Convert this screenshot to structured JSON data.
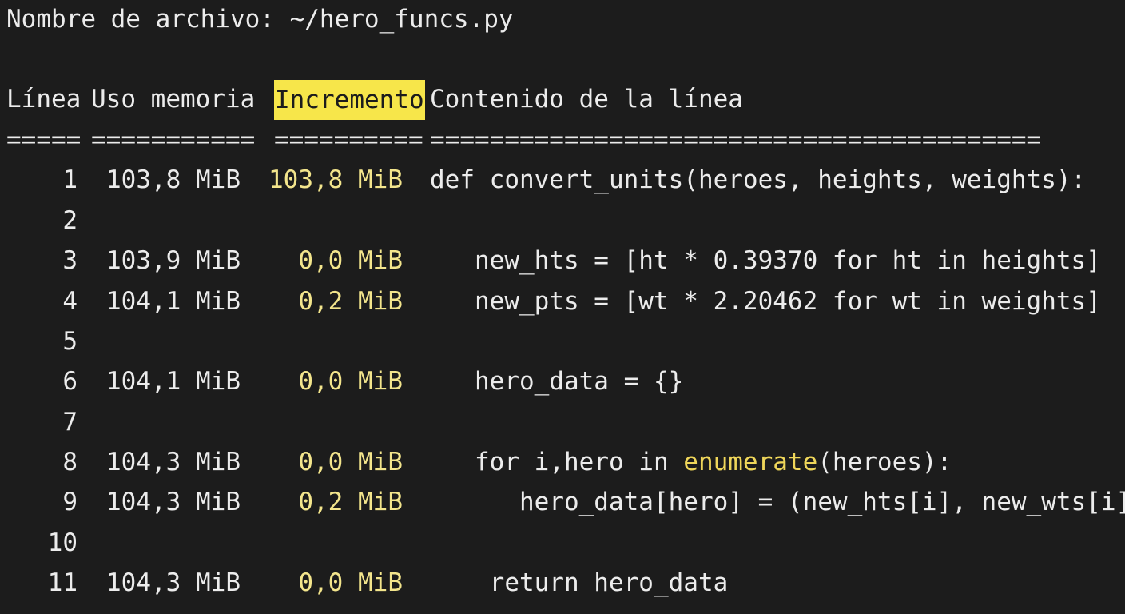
{
  "file": {
    "label": "Nombre de archivo: ~/hero_funcs.py"
  },
  "header": {
    "line": "Línea",
    "memory": "Uso memoria",
    "increment": "Incremento",
    "content": "Contenido de la línea"
  },
  "separator": {
    "line": "=====",
    "memory": "===========",
    "increment": "==========",
    "content": "========================================="
  },
  "rows": [
    {
      "num": "1",
      "mem": "103,8 MiB",
      "inc": "103,8 MiB",
      "code": "def convert_units(heroes, heights, weights):"
    },
    {
      "num": "2",
      "mem": "",
      "inc": "",
      "code": ""
    },
    {
      "num": "3",
      "mem": "103,9 MiB",
      "inc": "0,0 MiB",
      "code": "   new_hts = [ht * 0.39370 for ht in heights]"
    },
    {
      "num": "4",
      "mem": "104,1 MiB",
      "inc": "0,2 MiB",
      "code": "   new_pts = [wt * 2.20462 for wt in weights]"
    },
    {
      "num": "5",
      "mem": "",
      "inc": "",
      "code": ""
    },
    {
      "num": "6",
      "mem": "104,1 MiB",
      "inc": "0,0 MiB",
      "code": "   hero_data = {}"
    },
    {
      "num": "7",
      "mem": "",
      "inc": "",
      "code": ""
    },
    {
      "num": "8",
      "mem": "104,3 MiB",
      "inc": "0,0 MiB",
      "code_pre": "   for i,hero in ",
      "code_fn": "enumerate",
      "code_post": "(heroes):"
    },
    {
      "num": "9",
      "mem": "104,3 MiB",
      "inc": "0,2 MiB",
      "code": "      hero_data[hero] = (new_hts[i], new_wts[i])"
    },
    {
      "num": "10",
      "mem": "",
      "inc": "",
      "code": ""
    },
    {
      "num": "11",
      "mem": "104,3 MiB",
      "inc": "0,0 MiB",
      "code": "    return hero_data"
    }
  ],
  "colors": {
    "background": "#1c1c1c",
    "text": "#ececec",
    "increment_text": "#f3e58c",
    "header_highlight": "#f7e64a",
    "builtin_function": "#efd65a"
  }
}
